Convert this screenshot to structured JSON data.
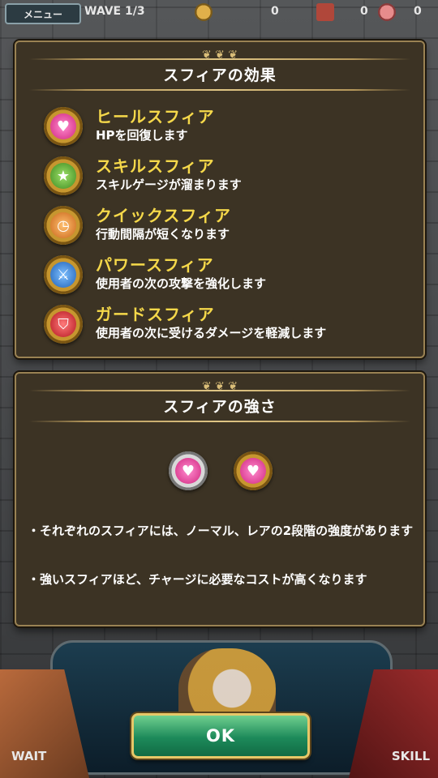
{
  "hud": {
    "menu_label": "メニュー",
    "wave_label": "WAVE 1/3",
    "coin_count": "0",
    "chest_count": "0",
    "potion_count": "0"
  },
  "effects_panel": {
    "title": "スフィアの効果",
    "items": [
      {
        "name": "ヒールスフィア",
        "desc": "HPを回復します",
        "icon": "heart-sphere-icon",
        "color": "#e94aa0"
      },
      {
        "name": "スキルスフィア",
        "desc": "スキルゲージが溜まります",
        "icon": "star-sphere-icon",
        "color": "#5fb53a"
      },
      {
        "name": "クイックスフィア",
        "desc": "行動間隔が短くなります",
        "icon": "clock-sphere-icon",
        "color": "#e58a24"
      },
      {
        "name": "パワースフィア",
        "desc": "使用者の次の攻撃を強化します",
        "icon": "sword-sphere-icon",
        "color": "#2e7fd6"
      },
      {
        "name": "ガードスフィア",
        "desc": "使用者の次に受けるダメージを軽減します",
        "icon": "shield-sphere-icon",
        "color": "#d7313a"
      }
    ]
  },
  "strength_panel": {
    "title": "スフィアの強さ",
    "notes": [
      "・それぞれのスフィアには、ノーマル、レアの2段階の強度があります",
      "・強いスフィアほど、チャージに必要なコストが高くなります"
    ]
  },
  "controls": {
    "wait_label": "WAIT",
    "skill_label": "SKILL",
    "ok_label": "OK"
  }
}
